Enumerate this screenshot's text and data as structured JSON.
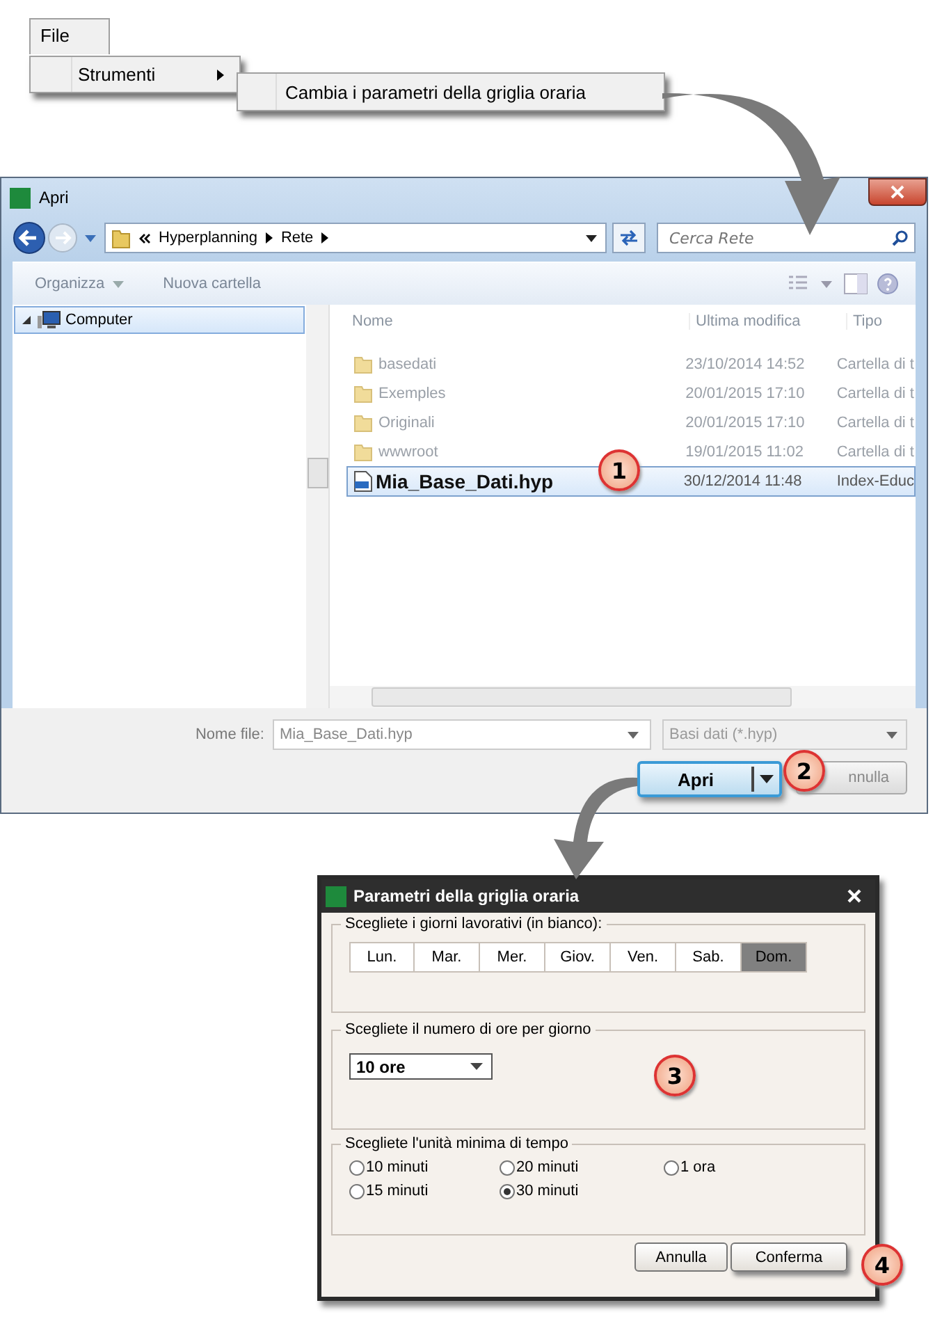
{
  "menu": {
    "top": "File",
    "items": [
      {
        "label": "Strumenti",
        "submenu": "Cambia i parametri della griglia oraria"
      }
    ]
  },
  "open_dialog": {
    "title": "Apri",
    "breadcrumb": [
      "Hyperplanning",
      "Rete"
    ],
    "search": {
      "placeholder": "Cerca Rete"
    },
    "toolbar": [
      "Organizza",
      "Nuova cartella"
    ],
    "nav": [
      {
        "label": "Computer",
        "selected": true
      }
    ],
    "columns": [
      "Nome",
      "Ultima modifica",
      "Tipo"
    ],
    "files": [
      {
        "kind": "folder",
        "name": "basedati",
        "modified": "23/10/2014 14:52",
        "type": "Cartella di t",
        "selected": false
      },
      {
        "kind": "folder",
        "name": "Exemples",
        "modified": "20/01/2015 17:10",
        "type": "Cartella di t",
        "selected": false
      },
      {
        "kind": "folder",
        "name": "Originali",
        "modified": "20/01/2015 17:10",
        "type": "Cartella di t",
        "selected": false
      },
      {
        "kind": "folder",
        "name": "wwwroot",
        "modified": "19/01/2015 11:02",
        "type": "Cartella di t",
        "selected": false
      },
      {
        "kind": "file",
        "name": "Mia_Base_Dati.hyp",
        "modified": "30/12/2014 11:48",
        "type": "Index-Educ",
        "selected": true
      }
    ],
    "filename_label": "Nome file:",
    "filename": "Mia_Base_Dati.hyp",
    "filter": "Basi dati (*.hyp)",
    "open_button": "Apri",
    "cancel_button": "nnulla"
  },
  "grid_dialog": {
    "title": "Parametri della griglia oraria",
    "days_label": "Scegliete i giorni lavorativi (in bianco):",
    "days": [
      {
        "label": "Lun.",
        "working": true
      },
      {
        "label": "Mar.",
        "working": true
      },
      {
        "label": "Mer.",
        "working": true
      },
      {
        "label": "Giov.",
        "working": true
      },
      {
        "label": "Ven.",
        "working": true
      },
      {
        "label": "Sab.",
        "working": true
      },
      {
        "label": "Dom.",
        "working": false
      }
    ],
    "hours_label": "Scegliete il numero di ore per giorno",
    "hours": "10 ore",
    "unit_label": "Scegliete l'unità minima di tempo",
    "units": [
      {
        "label": "10 minuti",
        "selected": false
      },
      {
        "label": "20 minuti",
        "selected": false
      },
      {
        "label": "1 ora",
        "selected": false
      },
      {
        "label": "15 minuti",
        "selected": false
      },
      {
        "label": "30 minuti",
        "selected": true
      }
    ],
    "buttons": [
      "Annulla",
      "Conferma"
    ]
  },
  "steps": [
    "1",
    "2",
    "3",
    "4"
  ]
}
